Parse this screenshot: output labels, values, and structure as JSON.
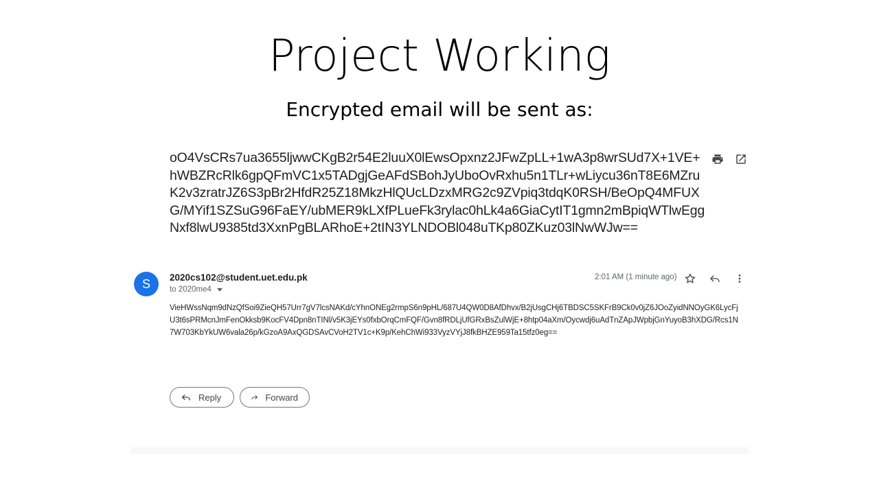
{
  "slide": {
    "title": "Project Working",
    "subtitle": "Encrypted email will be sent as:"
  },
  "email": {
    "subject": "oO4VsCRs7ua3655ljwwCKgB2r54E2luuX0lEwsOpxnz2JFwZpLL+1wA3p8wrSUd7X+1VE+hWBZRcRlk6gpQFmVC1x5TADgjGeAFdSBohJyUboOvRxhu5n1TLr+wLiycu36nT8E6MZruK2v3zratrJZ6S3pBr2HfdR25Z18MkzHlQUcLDzxMRG2c9ZVpiq3tdqK0RSH/BeOpQ4MFUXG/MYif1SZSuG96FaEY/ubMER9kLXfPLueFk3rylac0hLk4a6GiaCytIT1gmn2mBpiqWTlwEggNxf8lwU9385td3XxnPgBLARhoE+2tIN3YLNDOBl048uTKp80ZKuz03lNwWJw==",
    "avatar_letter": "S",
    "sender": "2020cs102@student.uet.edu.pk",
    "recipient": "to 2020me4",
    "timestamp": "2:01 AM (1 minute ago)",
    "body": "VieHWssNqm9dNzQfSoi9ZieQH57Urr7gV7lcsNAKd/cYhnONEg2rmpS6n9pHL/687U4QW0D8AfDhvx/B2jUsgCHj6TBDSC5SKFrB9Ck0v0jZ6JOoZyidNNOyGK6LycFjU3t6sPRMcnJmFenOkksb9KocFV4Dpn8nTINl/v5K3jEYs0fxbOrqCmFQF/Gvn8fRDLjUfGRxBsZulWjE+8htp04aXm/Oycwdj6uAdTnZApJWpbjGnYuyoB3hXDG/Rcs1N7W703KbYkUW6vala26p/kGzoA9AxQGDSAvCVoH2TV1c+K9p/KehChWi933VyzVYjJ8fkBHZE959Ta15tfz0eg==",
    "reply_label": "Reply",
    "forward_label": "Forward"
  },
  "icons": {
    "print": "print-icon",
    "open_new_window": "open-in-new-icon",
    "star": "star-icon",
    "reply": "reply-icon",
    "more": "more-vert-icon",
    "forward": "forward-icon"
  },
  "colors": {
    "avatar_bg": "#1a73e8",
    "text": "#1f1f1f",
    "muted": "#5f6368"
  }
}
